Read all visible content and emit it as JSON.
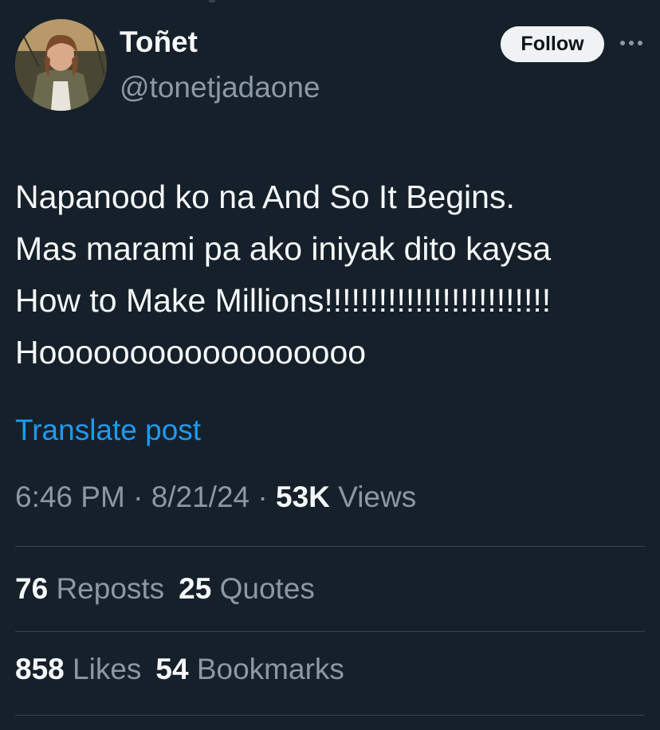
{
  "author": {
    "name": "Toñet",
    "handle": "@tonetjadaone"
  },
  "actions": {
    "follow_label": "Follow"
  },
  "tweet": {
    "lines": [
      "Napanood ko na And So It Begins.",
      "Mas marami pa ako iniyak dito kaysa",
      "How to Make Millions!!!!!!!!!!!!!!!!!!!!!!!!!",
      "Hoooooooooooooooooo"
    ],
    "translate_label": "Translate post"
  },
  "meta": {
    "time": "6:46 PM",
    "date": "8/21/24",
    "views_count": "53K",
    "views_label": "Views",
    "separator": "·"
  },
  "stats": {
    "reposts_count": "76",
    "reposts_label": "Reposts",
    "quotes_count": "25",
    "quotes_label": "Quotes",
    "likes_count": "858",
    "likes_label": "Likes",
    "bookmarks_count": "54",
    "bookmarks_label": "Bookmarks"
  },
  "colors": {
    "background": "#15202b",
    "primary_text": "#f7f9f9",
    "secondary_text": "#8b98a5",
    "link": "#1d9bf0",
    "divider": "#38444d",
    "follow_button_bg": "#eff3f4"
  }
}
